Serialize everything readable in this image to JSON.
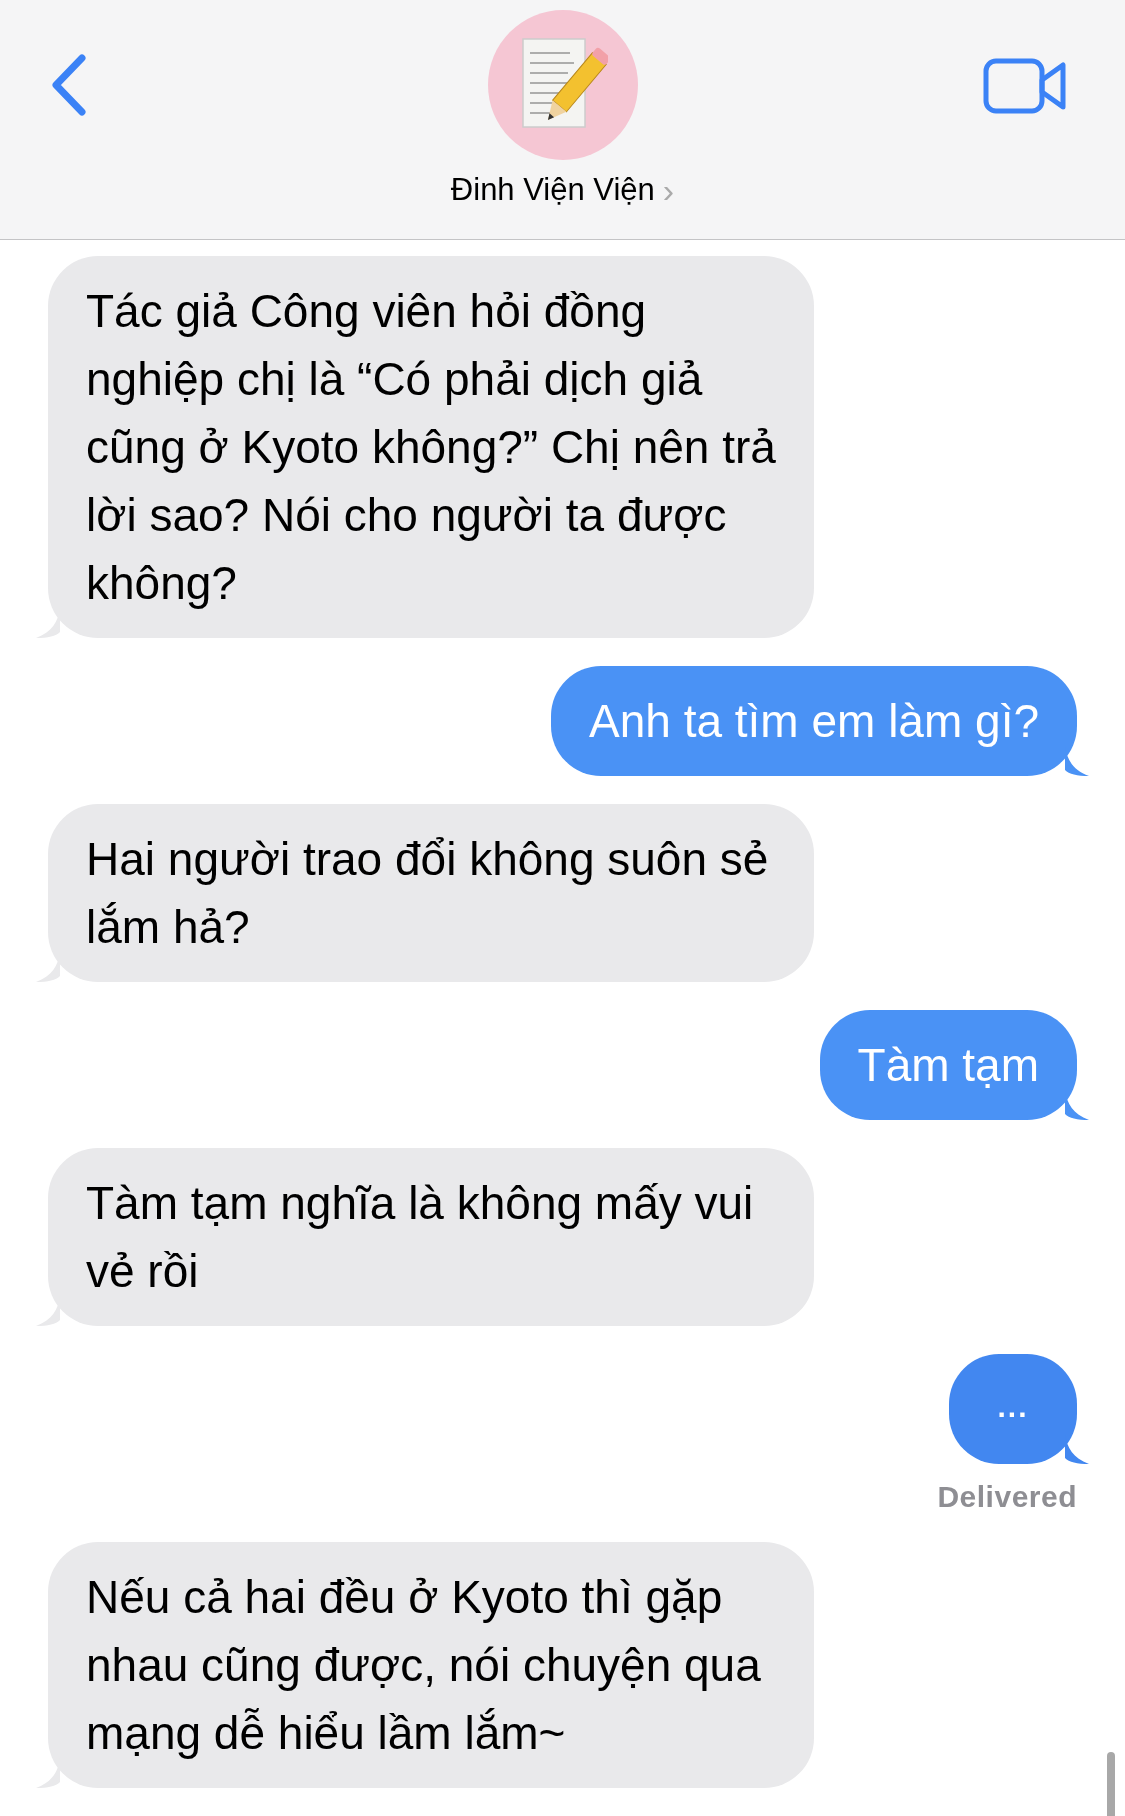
{
  "header": {
    "contact_name": "Đinh Viện Viện",
    "chevron": "›"
  },
  "messages": [
    {
      "kind": "received",
      "text": "Tác giả Công viên hỏi đồng nghiệp chị là “Có phải dịch giả cũng ở Kyoto không?” Chị nên trả lời sao? Nói cho người ta được không?"
    },
    {
      "kind": "sent",
      "text": "Anh ta tìm em làm gì?"
    },
    {
      "kind": "received",
      "text": "Hai người trao đổi không suôn sẻ lắm hả?"
    },
    {
      "kind": "sent",
      "text": "Tàm tạm"
    },
    {
      "kind": "received",
      "text": "Tàm tạm nghĩa là không mấy vui vẻ rồi"
    },
    {
      "kind": "typing",
      "text": "...",
      "status": "Delivered"
    },
    {
      "kind": "received",
      "text": "Nếu cả hai đều ở Kyoto thì gặp nhau cũng được, nói chuyện qua mạng dễ hiểu lầm lắm~"
    }
  ]
}
